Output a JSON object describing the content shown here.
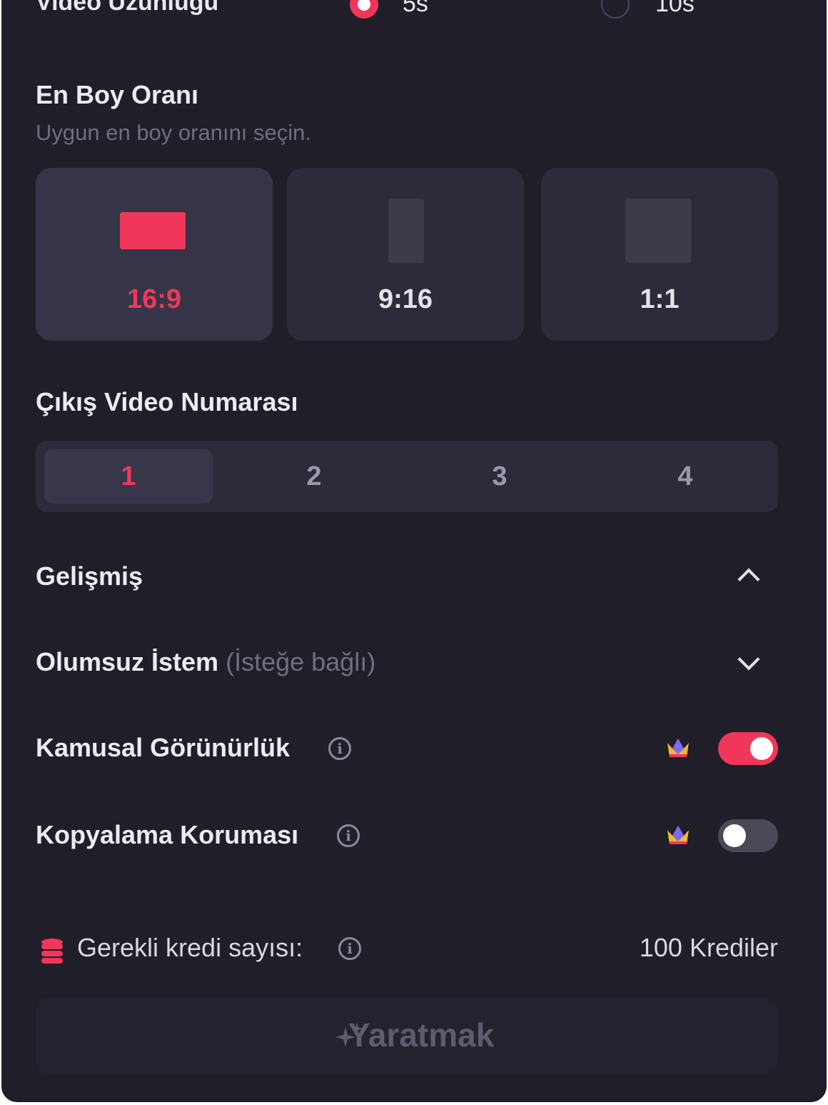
{
  "duration": {
    "label": "Video Uzunluğu",
    "options": [
      {
        "label": "5s",
        "selected": true
      },
      {
        "label": "10s",
        "selected": false
      }
    ]
  },
  "aspect": {
    "title": "En Boy Oranı",
    "subtitle": "Uygun en boy oranını seçin.",
    "options": [
      {
        "label": "16:9",
        "selected": true
      },
      {
        "label": "9:16",
        "selected": false
      },
      {
        "label": "1:1",
        "selected": false
      }
    ]
  },
  "output": {
    "title": "Çıkış Video Numarası",
    "options": [
      "1",
      "2",
      "3",
      "4"
    ],
    "selected": "1"
  },
  "advanced": {
    "title": "Gelişmiş",
    "negative_prompt_label": "Olumsuz İstem",
    "negative_prompt_hint": "(İsteğe bağlı)",
    "public_visibility_label": "Kamusal Görünürlük",
    "public_visibility_on": true,
    "copy_protection_label": "Kopyalama Koruması",
    "copy_protection_on": false
  },
  "credits": {
    "label": "Gerekli kredi sayısı:",
    "value": "100 Krediler"
  },
  "create_button_label": "Yaratmak",
  "colors": {
    "accent": "#f0375a",
    "panel_bg": "#1f1e29",
    "card_bg": "#2c2b39"
  },
  "icons": [
    "info-icon",
    "crown-icon",
    "coins-icon",
    "sparkle-icon",
    "chevron-up-icon",
    "chevron-down-icon"
  ]
}
